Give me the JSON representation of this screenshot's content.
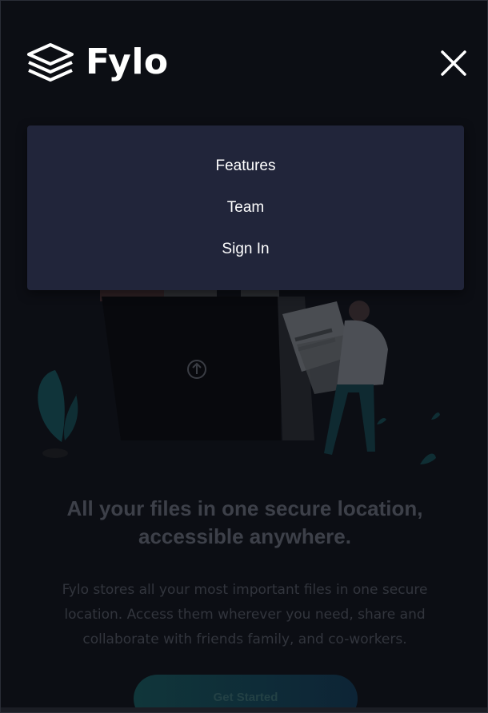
{
  "header": {
    "logo_text": "Fylo",
    "logo_icon": "layers-icon",
    "close_icon": "close-icon"
  },
  "menu": {
    "items": [
      {
        "label": "Features"
      },
      {
        "label": "Team"
      },
      {
        "label": "Sign In"
      }
    ]
  },
  "hero": {
    "illustration_icon": "upload-arrow-icon",
    "headline_line1": "All your files in one secure location,",
    "headline_line2": "accessible anywhere.",
    "body_line1": "Fylo stores all your most important files in one secure",
    "body_line2": "location. Access them wherever you need, share and",
    "body_line3": "collaborate with friends family, and co-workers.",
    "cta_label": "Get Started"
  },
  "colors": {
    "background": "#0c0e14",
    "menu_background": "#21253a",
    "menu_text": "#ffffff",
    "dim_text": "#3d4049",
    "cta_gradient_start": "#10363a",
    "cta_gradient_end": "#0d2436"
  }
}
